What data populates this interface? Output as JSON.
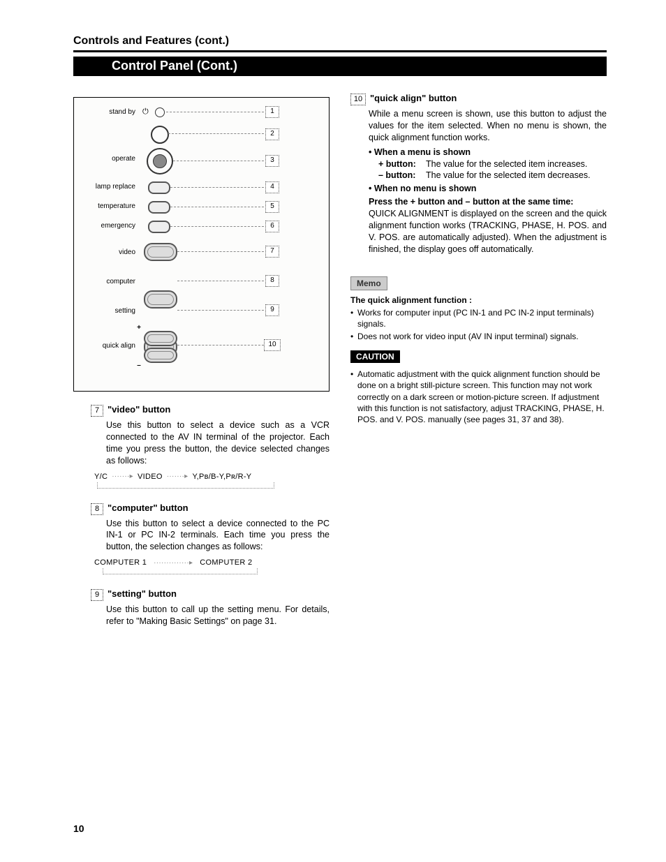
{
  "header": {
    "section_title": "Controls and Features (cont.)",
    "bar_title": "Control Panel (Cont.)"
  },
  "diagram": {
    "labels": {
      "standby": "stand by",
      "operate": "operate",
      "lamp_replace": "lamp replace",
      "temperature": "temperature",
      "emergency": "emergency",
      "video": "video",
      "computer": "computer",
      "setting": "setting",
      "quick_align": "quick align",
      "plus": "+",
      "minus": "–"
    },
    "callouts": {
      "n1": "1",
      "n2": "2",
      "n3": "3",
      "n4": "4",
      "n5": "5",
      "n6": "6",
      "n7": "7",
      "n8": "8",
      "n9": "9",
      "n10": "10"
    }
  },
  "left": {
    "item7": {
      "num": "7",
      "title": "\"video\" button",
      "body": "Use this button to select a device such as a VCR connected to the AV IN terminal of the projector. Each time you press the button, the device selected changes as follows:",
      "cycle_a": "Y/C",
      "cycle_b": "VIDEO",
      "cycle_c": "Y,Pʙ/B-Y,Pʀ/R-Y"
    },
    "item8": {
      "num": "8",
      "title": "\"computer\" button",
      "body": "Use this button to select a device connected to the PC IN-1 or PC IN-2 terminals. Each time you press the button, the selection changes as follows:",
      "cycle_a": "COMPUTER 1",
      "cycle_b": "COMPUTER 2"
    },
    "item9": {
      "num": "9",
      "title": "\"setting\" button",
      "body": "Use this button to call up the setting menu. For details, refer to \"Making Basic Settings\" on page 31."
    }
  },
  "right": {
    "item10": {
      "num": "10",
      "title": "\"quick align\" button",
      "intro": "While a menu screen is shown, use this button to adjust the values for the item selected. When no menu is shown, the quick alignment function works.",
      "when_menu": "When a menu is shown",
      "plus_label": "+ button:",
      "plus_text": "The value for the selected item increases.",
      "minus_label": "– button:",
      "minus_text": "The value for the selected item decreases.",
      "when_no_menu": "When no menu is shown",
      "press_line": "Press the + button and – button at the same time:",
      "press_body": "QUICK ALIGNMENT is displayed on the screen and the quick alignment function works (TRACKING, PHASE, H. POS. and V. POS. are automatically adjusted). When the adjustment is finished, the display goes off automatically."
    },
    "memo": {
      "tag": "Memo",
      "lead": "The quick alignment function :",
      "b1": "Works for computer input (PC IN-1 and PC IN-2 input terminals) signals.",
      "b2": "Does not work for video input (AV IN input terminal) signals."
    },
    "caution": {
      "tag": "CAUTION",
      "b1": "Automatic adjustment with the quick alignment function should be done on a bright still-picture screen. This function may not work correctly on a dark screen or motion-picture screen. If adjustment with this function is not satisfactory, adjust TRACKING, PHASE, H. POS. and V. POS. manually (see pages 31, 37 and 38)."
    }
  },
  "page_number": "10"
}
